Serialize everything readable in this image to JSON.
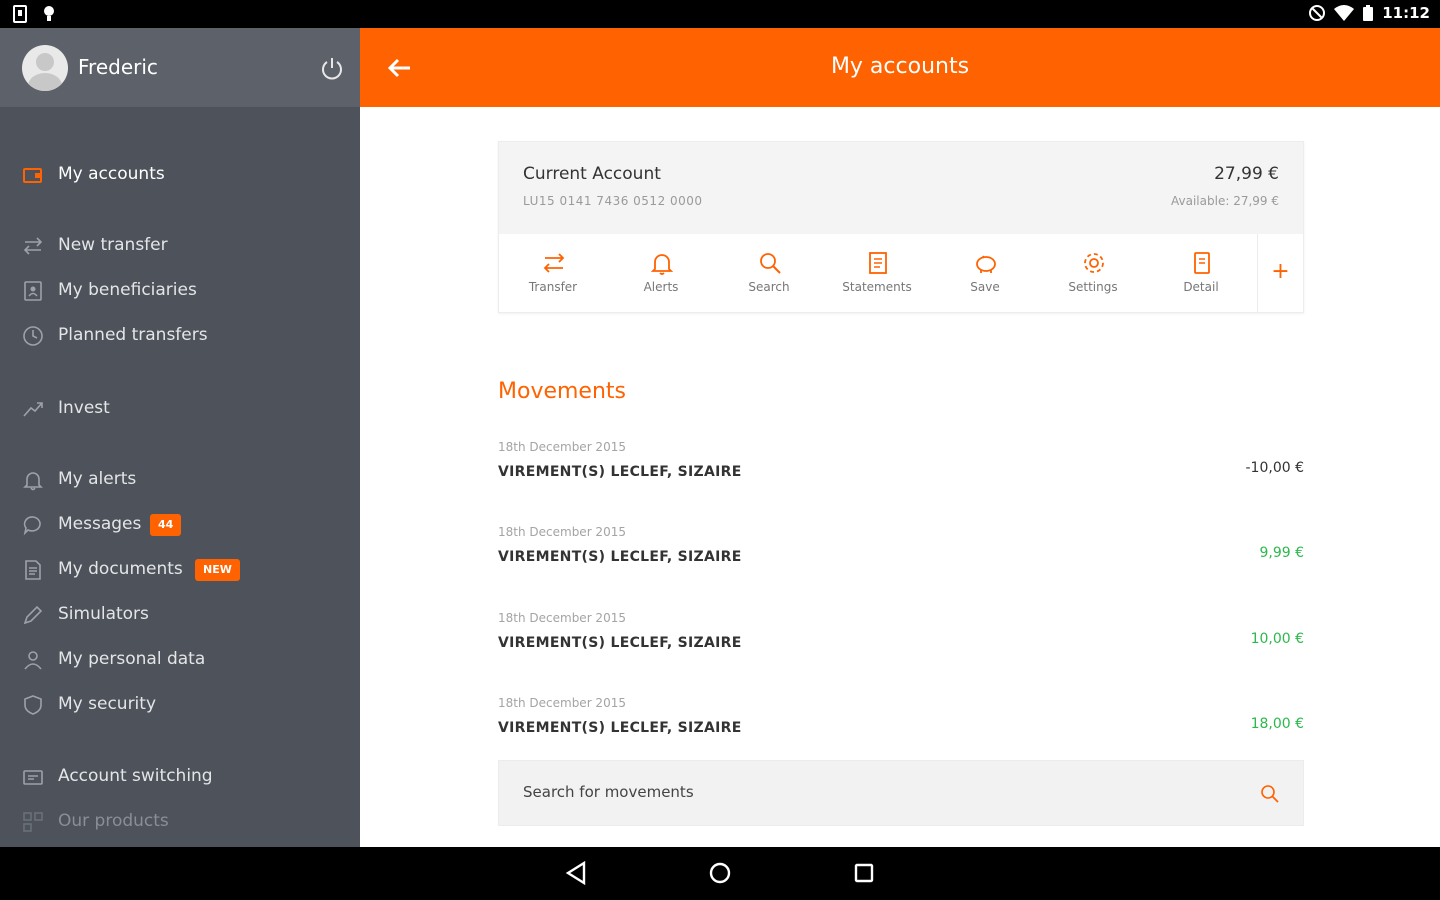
{
  "status_bar": {
    "time": "11:12"
  },
  "user": {
    "name": "Frederic"
  },
  "header": {
    "title": "My accounts"
  },
  "colors": {
    "accent": "#ff6200",
    "sidebar": "#4d525b",
    "positive": "#2db84d",
    "negative": "#333333"
  },
  "sidebar": {
    "items": [
      {
        "label": "My accounts",
        "icon": "wallet-icon"
      },
      {
        "label": "New transfer",
        "icon": "transfer-icon"
      },
      {
        "label": "My beneficiaries",
        "icon": "contacts-icon"
      },
      {
        "label": "Planned transfers",
        "icon": "clock-icon"
      },
      {
        "label": "Invest",
        "icon": "trend-icon"
      },
      {
        "label": "My alerts",
        "icon": "bell-icon"
      },
      {
        "label": "Messages",
        "icon": "chat-icon",
        "badge": "44"
      },
      {
        "label": "My documents",
        "icon": "document-icon",
        "badge": "NEW"
      },
      {
        "label": "Simulators",
        "icon": "pen-icon"
      },
      {
        "label": "My personal data",
        "icon": "user-icon"
      },
      {
        "label": "My security",
        "icon": "shield-icon"
      },
      {
        "label": "Account switching",
        "icon": "switch-icon"
      },
      {
        "label": "Our products",
        "icon": "products-icon"
      }
    ]
  },
  "account": {
    "name": "Current Account",
    "iban": "LU15 0141 7436 0512 0000",
    "balance": "27,99 €",
    "available": "Available: 27,99 €"
  },
  "actions": [
    {
      "label": "Transfer",
      "icon": "transfer-icon"
    },
    {
      "label": "Alerts",
      "icon": "bell-icon"
    },
    {
      "label": "Search",
      "icon": "search-icon"
    },
    {
      "label": "Statements",
      "icon": "statements-icon"
    },
    {
      "label": "Save",
      "icon": "piggy-bank-icon"
    },
    {
      "label": "Settings",
      "icon": "gear-icon"
    },
    {
      "label": "Detail",
      "icon": "detail-icon"
    }
  ],
  "more_label": "+",
  "movements": {
    "title": "Movements",
    "items": [
      {
        "date": "18th December 2015",
        "description": "VIREMENT(S) LECLEF, SIZAIRE",
        "amount": "-10,00  €",
        "type": "negative"
      },
      {
        "date": "18th December 2015",
        "description": "VIREMENT(S) LECLEF, SIZAIRE",
        "amount": "9,99  €",
        "type": "positive"
      },
      {
        "date": "18th December 2015",
        "description": "VIREMENT(S) LECLEF, SIZAIRE",
        "amount": "10,00  €",
        "type": "positive"
      },
      {
        "date": "18th December 2015",
        "description": "VIREMENT(S) LECLEF, SIZAIRE",
        "amount": "18,00  €",
        "type": "positive"
      }
    ]
  },
  "search": {
    "placeholder": "Search for movements"
  }
}
